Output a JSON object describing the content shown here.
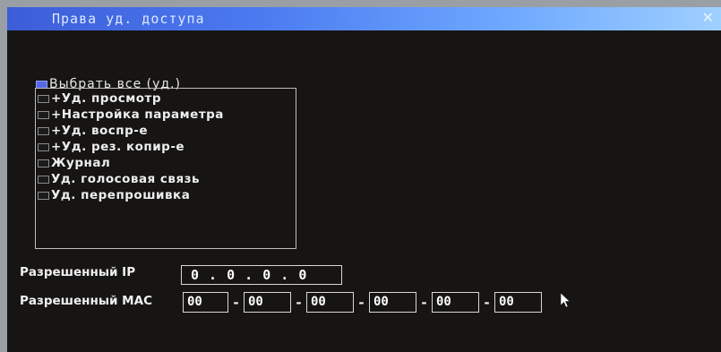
{
  "window": {
    "title": "Права уд. доступа",
    "close_glyph": "✕"
  },
  "select_all": {
    "label": "Выбрать все (уд.)",
    "checked": true
  },
  "permissions": [
    {
      "label": "+Уд. просмотр"
    },
    {
      "label": "+Настройка параметра"
    },
    {
      "label": "+Уд. воспр-е"
    },
    {
      "label": "+Уд. рез. копир-е"
    },
    {
      "label": "Журнал"
    },
    {
      "label": "Уд. голосовая связь"
    },
    {
      "label": "Уд. перепрошивка"
    }
  ],
  "allowed_ip": {
    "label": "Разрешенный IP",
    "value": "0 . 0 . 0 . 0"
  },
  "allowed_mac": {
    "label": "Разрешенный MAC",
    "separator": "-",
    "octets": [
      "00",
      "00",
      "00",
      "00",
      "00",
      "00"
    ]
  },
  "colors": {
    "title_bar_start": "#3d5dd8",
    "title_bar_end": "#9fd0ff",
    "checkbox_checked": "#5568e6",
    "background": "#161513"
  },
  "icons": {
    "cursor": "mouse-pointer-icon",
    "close": "close-icon"
  }
}
